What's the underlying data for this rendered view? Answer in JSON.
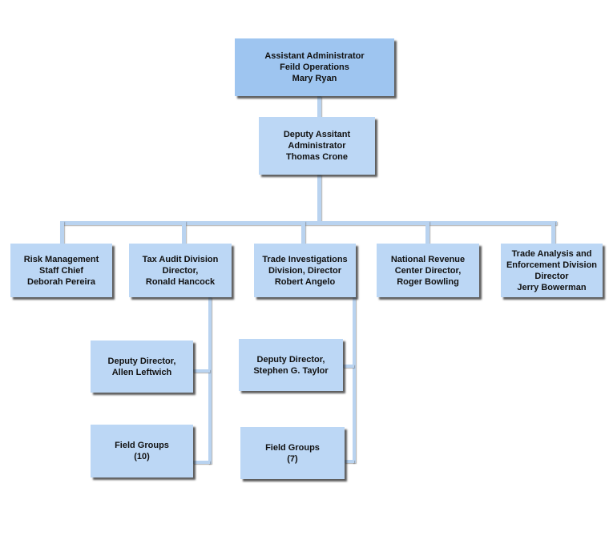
{
  "org_chart": {
    "top": {
      "lines": [
        "Assistant Administrator",
        "Feild Operations",
        "Mary Ryan"
      ]
    },
    "deputy": {
      "lines": [
        "Deputy Assitant",
        "Administrator",
        "Thomas Crone"
      ]
    },
    "divisions": [
      {
        "id": "risk-management",
        "lines": [
          "Risk Management",
          "Staff Chief",
          "Deborah Pereira"
        ]
      },
      {
        "id": "tax-audit",
        "lines": [
          "Tax Audit Division",
          "Director,",
          "Ronald Hancock"
        ]
      },
      {
        "id": "trade-investigations",
        "lines": [
          "Trade Investigations",
          "Division, Director",
          "Robert Angelo"
        ]
      },
      {
        "id": "national-revenue-center",
        "lines": [
          "National Revenue",
          "Center Director,",
          "Roger Bowling"
        ]
      },
      {
        "id": "trade-analysis",
        "lines": [
          "Trade Analysis and",
          "Enforcement Division",
          "Director",
          "Jerry Bowerman"
        ]
      }
    ],
    "tax_audit_subunits": [
      {
        "id": "tax-audit-deputy",
        "lines": [
          "Deputy Director,",
          "Allen Leftwich"
        ]
      },
      {
        "id": "tax-audit-field-groups",
        "lines": [
          "Field Groups",
          "(10)"
        ]
      }
    ],
    "trade_investigations_subunits": [
      {
        "id": "trade-inv-deputy",
        "lines": [
          "Deputy Director,",
          "Stephen G. Taylor"
        ]
      },
      {
        "id": "trade-inv-field-groups",
        "lines": [
          "Field Groups",
          "(7)"
        ]
      }
    ]
  },
  "colors": {
    "top_box": "#9ec5f0",
    "box": "#bcd7f5",
    "connector": "#b9d3f0"
  }
}
